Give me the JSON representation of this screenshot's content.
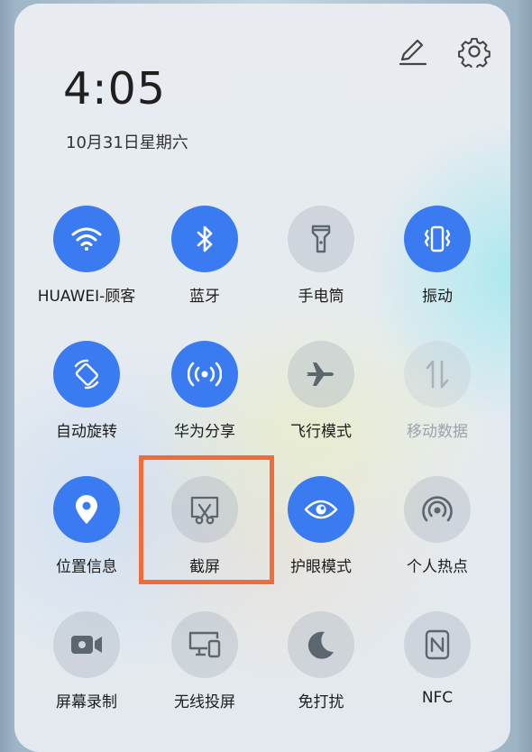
{
  "status": {
    "time": "4:05",
    "date": "10月31日星期六"
  },
  "header": {
    "edit_icon": "pencil-icon",
    "settings_icon": "gear-icon"
  },
  "tiles": [
    {
      "label": "HUAWEI-顾客",
      "icon": "wifi-icon",
      "state": "on"
    },
    {
      "label": "蓝牙",
      "icon": "bluetooth-icon",
      "state": "on"
    },
    {
      "label": "手电筒",
      "icon": "flashlight-icon",
      "state": "off"
    },
    {
      "label": "振动",
      "icon": "vibrate-icon",
      "state": "on"
    },
    {
      "label": "自动旋转",
      "icon": "rotate-icon",
      "state": "on"
    },
    {
      "label": "华为分享",
      "icon": "share-icon",
      "state": "on"
    },
    {
      "label": "飞行模式",
      "icon": "airplane-icon",
      "state": "off"
    },
    {
      "label": "移动数据",
      "icon": "mobile-data-icon",
      "state": "disabled"
    },
    {
      "label": "位置信息",
      "icon": "location-icon",
      "state": "on"
    },
    {
      "label": "截屏",
      "icon": "screenshot-icon",
      "state": "off"
    },
    {
      "label": "护眼模式",
      "icon": "eye-icon",
      "state": "on"
    },
    {
      "label": "个人热点",
      "icon": "hotspot-icon",
      "state": "off"
    },
    {
      "label": "屏幕录制",
      "icon": "screen-record-icon",
      "state": "off"
    },
    {
      "label": "无线投屏",
      "icon": "wireless-projection-icon",
      "state": "off"
    },
    {
      "label": "免打扰",
      "icon": "moon-icon",
      "state": "off"
    },
    {
      "label": "NFC",
      "icon": "nfc-icon",
      "state": "off"
    }
  ],
  "colors": {
    "active": "#3b7bf2",
    "highlight": "#f26b3a"
  }
}
